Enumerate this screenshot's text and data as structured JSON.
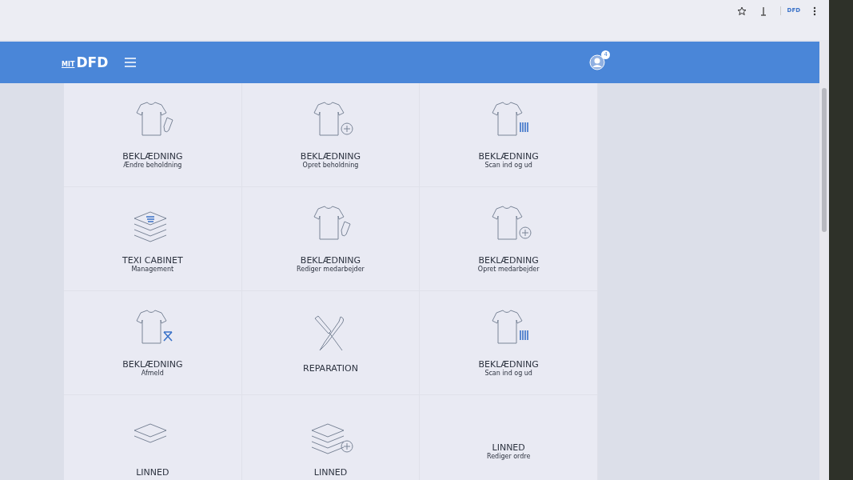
{
  "browser": {
    "extension_label": "DFD"
  },
  "header": {
    "logo_prefix": "MIT",
    "logo": "DFD",
    "notification_count": "4"
  },
  "tiles": [
    {
      "kind": "shirt-sock",
      "title": "BEKLÆDNING",
      "subtitle": "Ændre beholdning"
    },
    {
      "kind": "shirt-plus",
      "title": "BEKLÆDNING",
      "subtitle": "Opret beholdning"
    },
    {
      "kind": "shirt-barcode",
      "title": "BEKLÆDNING",
      "subtitle": "Scan ind og ud"
    },
    {
      "kind": "cabinet",
      "title": "TEXI CABINET",
      "subtitle": "Management"
    },
    {
      "kind": "shirt-sock",
      "title": "BEKLÆDNING",
      "subtitle": "Rediger medarbejder"
    },
    {
      "kind": "shirt-plus",
      "title": "BEKLÆDNING",
      "subtitle": "Opret medarbejder"
    },
    {
      "kind": "shirt-cross",
      "title": "BEKLÆDNING",
      "subtitle": "Afmeld"
    },
    {
      "kind": "tools",
      "title": "REPARATION"
    },
    {
      "kind": "shirt-barcode",
      "title": "BEKLÆDNING",
      "subtitle": "Scan ind og ud"
    },
    {
      "kind": "sheet",
      "title": "LINNED"
    },
    {
      "kind": "stack-plus",
      "title": "LINNED"
    },
    {
      "kind": "none",
      "title": "LINNED",
      "subtitle": "Rediger ordre"
    }
  ]
}
